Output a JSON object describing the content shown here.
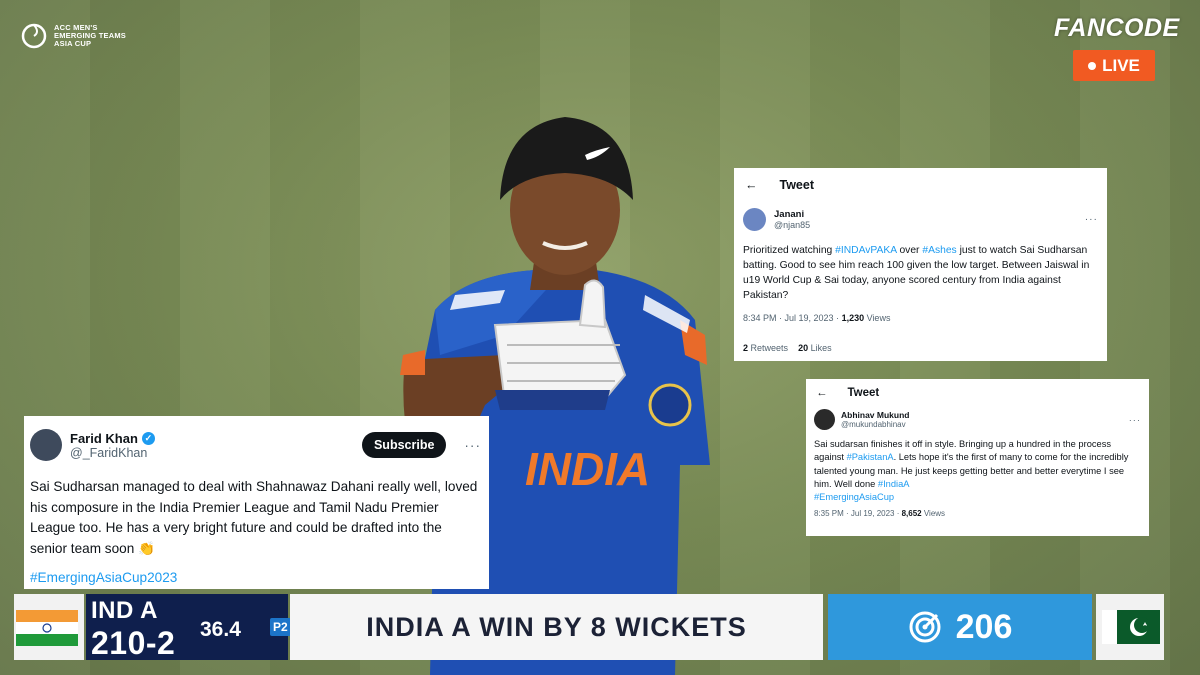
{
  "broadcast": {
    "tournament_logo_text": [
      "ACC MEN'S",
      "EMERGING TEAMS",
      "ASIA CUP"
    ],
    "broadcaster": "FANCODE",
    "live_label": "LIVE"
  },
  "player": {
    "jersey_text": "INDIA"
  },
  "tweets": {
    "janani": {
      "header": "Tweet",
      "name": "Janani",
      "handle": "@njan85",
      "body": [
        {
          "t": "Prioritized watching ",
          "h": false
        },
        {
          "t": "#INDAvPAKA",
          "h": true
        },
        {
          "t": " over ",
          "h": false
        },
        {
          "t": "#Ashes",
          "h": true
        },
        {
          "t": " just to watch Sai Sudharsan batting. Good to see him reach 100 given the low target. Between Jaiswal in u19 World Cup & Sai today, anyone scored century from India against Pakistan?",
          "h": false
        }
      ],
      "timestamp": "8:34 PM · Jul 19, 2023 · ",
      "views_count": "1,230",
      "views_label": " Views",
      "retweets_count": "2",
      "retweets_label": " Retweets",
      "likes_count": "20",
      "likes_label": " Likes"
    },
    "abhinav": {
      "header": "Tweet",
      "name": "Abhinav Mukund",
      "handle": "@mukundabhinav",
      "body": [
        {
          "t": "Sai sudarsan finishes it off in style. Bringing up a hundred in the process against ",
          "h": false
        },
        {
          "t": "#PakistanA",
          "h": true
        },
        {
          "t": ". Lets hope it's the first of many to come for the incredibly talented young man. He just keeps getting better and better everytime I see him. Well done ",
          "h": false
        },
        {
          "t": "#IndiaA",
          "h": true
        }
      ],
      "hashtag_line": "#EmergingAsiaCup",
      "timestamp": "8:35 PM · Jul 19, 2023 · ",
      "views_count": "8,652",
      "views_label": " Views"
    },
    "farid": {
      "name": "Farid Khan",
      "handle": "@_FaridKhan",
      "subscribe_label": "Subscribe",
      "body": "Sai Sudharsan managed to deal with Shahnawaz Dahani really well, loved his composure in the India Premier League and Tamil Nadu Premier League too. He has a very bright future and could be drafted into the senior team soon 👏",
      "hashtag_line": "#EmergingAsiaCup2023"
    }
  },
  "scorebar": {
    "team": "IND A",
    "score": "210-2",
    "overs": "36.4",
    "powerplay": "P2",
    "result": "INDIA A WIN BY 8 WICKETS",
    "target": "206"
  },
  "colors": {
    "tweet_hashtag": "#1d9bf0",
    "live_badge": "#f15a22",
    "team_box": "#0f1f4d",
    "target_box": "#2f98dc"
  }
}
